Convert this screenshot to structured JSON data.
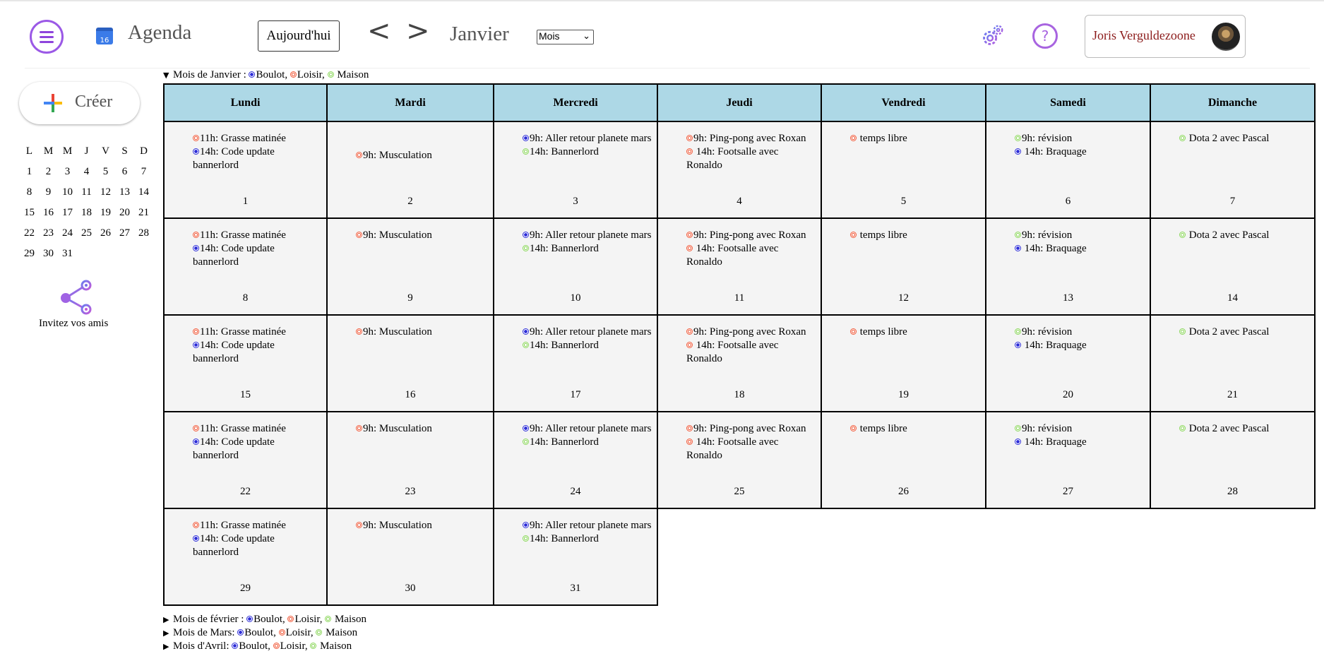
{
  "colors": {
    "boulot": "#2d2dd8",
    "loisir": "#f05a3a",
    "maison": "#8ad65a",
    "header_cell": "#add8e6",
    "day_cell": "#f4f4f4",
    "user_name": "#8b1a1a"
  },
  "header": {
    "menu_icon": "hamburger-menu-icon",
    "calendar_icon_number": "16",
    "app_title": "Agenda",
    "today_label": "Aujourd'hui",
    "prev_label": "<",
    "next_label": ">",
    "month_title": "Janvier",
    "view_select": {
      "selected": "Mois",
      "chevron": "⌄"
    },
    "settings_icon": "gear-icon",
    "help_icon": "help-icon",
    "help_glyph": "?",
    "user_name": "Joris Verguldezoone"
  },
  "sidebar": {
    "create_label": "Créer",
    "mini_calendar": {
      "weekdays": [
        "L",
        "M",
        "M",
        "J",
        "V",
        "S",
        "D"
      ],
      "weeks": [
        [
          "1",
          "2",
          "3",
          "4",
          "5",
          "6",
          "7"
        ],
        [
          "8",
          "9",
          "10",
          "11",
          "12",
          "13",
          "14"
        ],
        [
          "15",
          "16",
          "17",
          "18",
          "19",
          "20",
          "21"
        ],
        [
          "22",
          "23",
          "24",
          "25",
          "26",
          "27",
          "28"
        ],
        [
          "29",
          "30",
          "31",
          "",
          "",
          "",
          ""
        ]
      ]
    },
    "invite_label": "Invitez vos amis"
  },
  "summaries": {
    "janvier": {
      "prefix": "Mois de Janvier : ",
      "boulot": "Boulot, ",
      "loisir": "Loisir, ",
      "maison": " Maison",
      "expanded": true
    },
    "fevrier": {
      "prefix": "Mois de février : ",
      "boulot": "Boulot, ",
      "loisir": "Loisir, ",
      "maison": " Maison",
      "expanded": false
    },
    "mars": {
      "prefix": "Mois de Mars: ",
      "boulot": "Boulot, ",
      "loisir": "Loisir, ",
      "maison": " Maison",
      "expanded": false
    },
    "avril": {
      "prefix": "Mois d'Avril: ",
      "boulot": "Boulot, ",
      "loisir": "Loisir, ",
      "maison": " Maison",
      "expanded": false
    }
  },
  "calendar": {
    "weekdays": [
      "Lundi",
      "Mardi",
      "Mercredi",
      "Jeudi",
      "Vendredi",
      "Samedi",
      "Dimanche"
    ],
    "events_by_weekday": [
      [
        {
          "cat": "loisir",
          "text": "11h: Grasse matinée"
        },
        {
          "cat": "boulot",
          "text": "14h: Code update bannerlord"
        }
      ],
      [
        {
          "cat": "loisir",
          "text": "9h: Musculation"
        }
      ],
      [
        {
          "cat": "boulot",
          "text": "9h: Aller retour planete mars"
        },
        {
          "cat": "maison",
          "text": "14h: Bannerlord"
        }
      ],
      [
        {
          "cat": "loisir",
          "text": "9h: Ping-pong avec Roxan"
        },
        {
          "cat": "loisir",
          "text": " 14h: Footsalle avec Ronaldo"
        }
      ],
      [
        {
          "cat": "loisir",
          "text": " temps libre"
        }
      ],
      [
        {
          "cat": "maison",
          "text": "9h: révision"
        },
        {
          "cat": "boulot",
          "text": " 14h: Braquage"
        }
      ],
      [
        {
          "cat": "maison",
          "text": " Dota 2 avec Pascal"
        }
      ]
    ],
    "weeks": [
      [
        "1",
        "2",
        "3",
        "4",
        "5",
        "6",
        "7"
      ],
      [
        "8",
        "9",
        "10",
        "11",
        "12",
        "13",
        "14"
      ],
      [
        "15",
        "16",
        "17",
        "18",
        "19",
        "20",
        "21"
      ],
      [
        "22",
        "23",
        "24",
        "25",
        "26",
        "27",
        "28"
      ],
      [
        "29",
        "30",
        "31",
        "",
        "",
        "",
        ""
      ]
    ]
  }
}
